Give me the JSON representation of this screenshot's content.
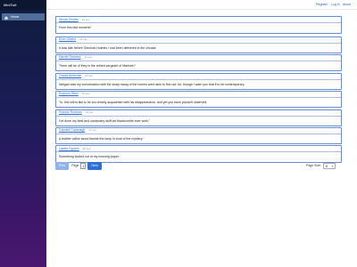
{
  "app": {
    "brand": "MiniTwit"
  },
  "sidebar": {
    "items": [
      {
        "label": "Home",
        "icon": "home-icon"
      }
    ]
  },
  "topbar": {
    "register": "Register",
    "login": "Log in",
    "about": "About"
  },
  "messages": [
    {
      "user": "Nicola Crooks",
      "time": "11 sec",
      "text": "From this last moment!"
    },
    {
      "user": "Elvin Okafor",
      "time": "14 sec",
      "text": "It was late before Sherlock Holmes I had been delivered in the circular."
    },
    {
      "user": "Harriet Ramirez",
      "time": "14 sec",
      "text": "There will be of they in the retired sergeant of Marines?"
    },
    {
      "user": "Gracia Ambrose",
      "time": "15 sec",
      "text": "Neligan was my conversation with the sharp slang of the homes were able to find out, for, though I warn you that it to be contemporary."
    },
    {
      "user": "Everson Stich",
      "time": "16 sec",
      "text": "\"In, this will is like to be too closely acquainted with his disappearance, and yet you have yourself observed."
    },
    {
      "user": "Frankie Rodman",
      "time": "16 sec",
      "text": "I've done my best and cautionary stuff we blackcombe ever work.\""
    },
    {
      "user": "Gannett Cavanagh",
      "time": "17 sec",
      "text": "A leather valise stood beside the lamp in front of the mystery.\""
    },
    {
      "user": "Lisette Dyckes",
      "time": "18 sec",
      "text": "Something looked out of my morning paper."
    }
  ],
  "pager": {
    "prev": "Prev",
    "page_label": "Page",
    "page_number": "1",
    "next": "Next"
  },
  "page_size": {
    "label": "Page Size:",
    "value": "8"
  },
  "colors": {
    "accent": "#2f6fd8",
    "sidebar_top": "#0f1c3d",
    "sidebar_bottom": "#4a1770"
  }
}
